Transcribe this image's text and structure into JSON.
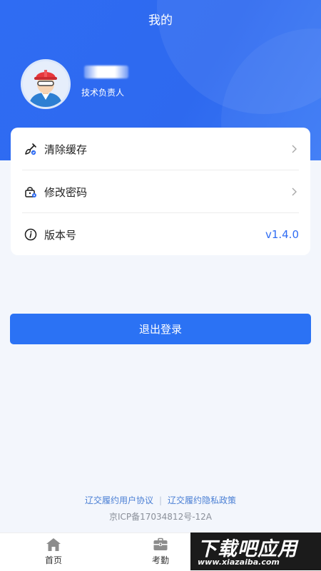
{
  "header": {
    "title": "我的"
  },
  "profile": {
    "role": "技术负责人"
  },
  "menu": {
    "items": [
      {
        "label": "清除缓存",
        "icon": "broom-icon"
      },
      {
        "label": "修改密码",
        "icon": "lock-icon"
      },
      {
        "label": "版本号",
        "icon": "info-icon",
        "value": "v1.4.0"
      }
    ]
  },
  "actions": {
    "logout_label": "退出登录"
  },
  "footer": {
    "user_agreement": "辽交履约用户协议",
    "separator": "|",
    "privacy_policy": "辽交履约隐私政策",
    "icp": "京ICP备17034812号-12A"
  },
  "tabbar": {
    "items": [
      {
        "label": "首页",
        "icon": "home-icon"
      },
      {
        "label": "考勤",
        "icon": "briefcase-icon"
      }
    ]
  },
  "watermark": {
    "big": "下载吧应用",
    "small": "www.xiazaiba.com"
  },
  "colors": {
    "primary": "#2f6cf3",
    "button": "#2b72f4",
    "link": "#4a7fd4"
  }
}
